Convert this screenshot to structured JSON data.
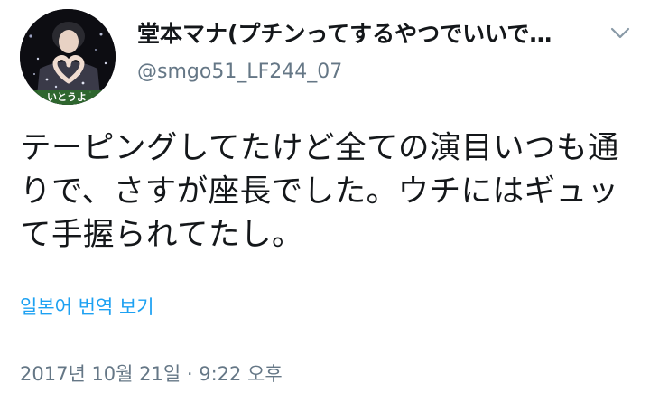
{
  "tweet": {
    "display_name": "堂本マナ(プチンってするやつでいいで…",
    "username": "@smgo51_LF244_07",
    "text_line1": "テーピングしてたけど全ての演目いつも通",
    "text_line2": "りで、さすが座長でした。ウチにはギュッ",
    "text_line3": "て手握られてたし。",
    "translate_label": "일본어 번역 보기",
    "timestamp": "2017년 10월 21일 · 9:22 오후",
    "avatar_caption": "いとうよ"
  },
  "colors": {
    "name": "#14171a",
    "secondary": "#657786",
    "link": "#1da1f2"
  },
  "icons": {
    "menu": "chevron-down-icon",
    "avatar": "profile-photo"
  }
}
